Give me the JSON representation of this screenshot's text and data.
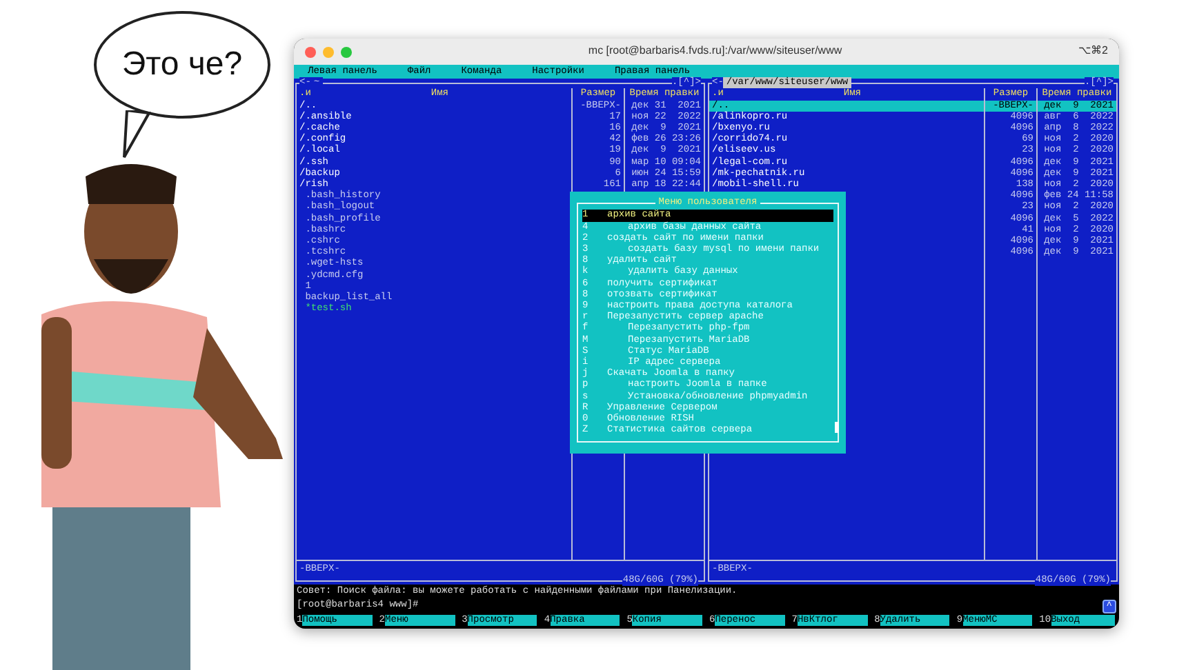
{
  "speech_bubble": {
    "text": "Это че?"
  },
  "window": {
    "title": "mc [root@barbaris4.fvds.ru]:/var/www/siteuser/www",
    "shortcut": "⌥⌘2"
  },
  "menu_bar": [
    "Левая панель",
    "Файл",
    "Команда",
    "Настройки",
    "Правая панель"
  ],
  "panels": [
    {
      "nav_left": "<-",
      "path": "~",
      "nav_right": ".[^]>",
      "active": false,
      "columns": [
        ".и",
        "Имя",
        "Размер",
        "Время правки"
      ],
      "rows": [
        {
          "name": "/..",
          "size": "-ВВЕРХ-",
          "time": "дек 31  2021",
          "kind": "dir",
          "selected": false
        },
        {
          "name": "/.ansible",
          "size": "17",
          "time": "ноя 22  2022",
          "kind": "dir",
          "selected": false
        },
        {
          "name": "/.cache",
          "size": "16",
          "time": "дек  9  2021",
          "kind": "dir",
          "selected": false
        },
        {
          "name": "/.config",
          "size": "42",
          "time": "фев 26 23:26",
          "kind": "dir",
          "selected": false
        },
        {
          "name": "/.local",
          "size": "19",
          "time": "дек  9  2021",
          "kind": "dir",
          "selected": false
        },
        {
          "name": "/.ssh",
          "size": "90",
          "time": "мар 10 09:04",
          "kind": "dir",
          "selected": false
        },
        {
          "name": "/backup",
          "size": "6",
          "time": "июн 24 15:59",
          "kind": "dir",
          "selected": false
        },
        {
          "name": "/rish",
          "size": "161",
          "time": "апр 18 22:44",
          "kind": "dir",
          "selected": false
        },
        {
          "name": ".bash_history",
          "kind": "file",
          "selected": false
        },
        {
          "name": ".bash_logout",
          "kind": "file",
          "selected": false
        },
        {
          "name": ".bash_profile",
          "kind": "file",
          "selected": false
        },
        {
          "name": ".bashrc",
          "kind": "file",
          "selected": false
        },
        {
          "name": ".cshrc",
          "kind": "file",
          "selected": false
        },
        {
          "name": ".tcshrc",
          "kind": "file",
          "selected": false
        },
        {
          "name": ".wget-hsts",
          "kind": "file",
          "selected": false
        },
        {
          "name": ".ydcmd.cfg",
          "kind": "file",
          "selected": false
        },
        {
          "name": "1",
          "kind": "file",
          "selected": false
        },
        {
          "name": "backup_list_all",
          "kind": "file",
          "selected": false
        },
        {
          "name": "*test.sh",
          "kind": "exec",
          "selected": false
        }
      ],
      "status": "-ВВЕРХ-",
      "disk": "48G/60G (79%)"
    },
    {
      "nav_left": "<-",
      "path": "/var/www/siteuser/www",
      "nav_right": ".[^]>",
      "active": true,
      "columns": [
        ".и",
        "Имя",
        "Размер",
        "Время правки"
      ],
      "rows": [
        {
          "name": "/..",
          "size": "-ВВЕРХ-",
          "time": "дек  9  2021",
          "kind": "dir",
          "selected": true
        },
        {
          "name": "/alinkopro.ru",
          "size": "4096",
          "time": "авг  6  2022",
          "kind": "dir",
          "selected": false
        },
        {
          "name": "/bxenyo.ru",
          "size": "4096",
          "time": "апр  8  2022",
          "kind": "dir",
          "selected": false
        },
        {
          "name": "/corrido74.ru",
          "size": "69",
          "time": "ноя  2  2020",
          "kind": "dir",
          "selected": false
        },
        {
          "name": "/eliseev.us",
          "size": "23",
          "time": "ноя  2  2020",
          "kind": "dir",
          "selected": false
        },
        {
          "name": "/legal-com.ru",
          "size": "4096",
          "time": "дек  9  2021",
          "kind": "dir",
          "selected": false
        },
        {
          "name": "/mk-pechatnik.ru",
          "size": "4096",
          "time": "дек  9  2021",
          "kind": "dir",
          "selected": false
        },
        {
          "name": "/mobil-shell.ru",
          "size": "138",
          "time": "ноя  2  2020",
          "kind": "dir",
          "selected": false
        },
        {
          "size": "4096",
          "time": "фев 24 11:58",
          "kind": "dir",
          "selected": false
        },
        {
          "size": "23",
          "time": "ноя  2  2020",
          "kind": "dir",
          "selected": false
        },
        {
          "size": "4096",
          "time": "дек  5  2022",
          "kind": "dir",
          "selected": false
        },
        {
          "size": "41",
          "time": "ноя  2  2020",
          "kind": "dir",
          "selected": false
        },
        {
          "size": "4096",
          "time": "дек  9  2021",
          "kind": "dir",
          "selected": false
        },
        {
          "size": "4096",
          "time": "дек  9  2021",
          "kind": "dir",
          "selected": false
        }
      ],
      "status": "-ВВЕРХ-",
      "disk": "48G/60G (79%)"
    }
  ],
  "user_menu": {
    "title": "Меню пользователя",
    "items": [
      {
        "key": "1",
        "label": "архив сайта",
        "indented": false,
        "selected": true
      },
      {
        "key": "4",
        "label": "архив базы данных сайта",
        "indented": true,
        "selected": false
      },
      {
        "key": "2",
        "label": "создать сайт по имени папки",
        "indented": false,
        "selected": false
      },
      {
        "key": "3",
        "label": "создать базу mysql по имени папки",
        "indented": true,
        "selected": false
      },
      {
        "key": "8",
        "label": "удалить сайт",
        "indented": false,
        "selected": false
      },
      {
        "key": "k",
        "label": "удалить базу данных",
        "indented": true,
        "selected": false
      },
      {
        "key": "6",
        "label": "получить сертификат",
        "indented": false,
        "selected": false
      },
      {
        "key": "8",
        "label": "отозвать сертификат",
        "indented": false,
        "selected": false
      },
      {
        "key": "9",
        "label": "настроить права доступа каталога",
        "indented": false,
        "selected": false
      },
      {
        "key": "r",
        "label": "Перезапустить сервер apache",
        "indented": false,
        "selected": false
      },
      {
        "key": "f",
        "label": "Перезапустить php-fpm",
        "indented": true,
        "selected": false
      },
      {
        "key": "M",
        "label": "Перезапустить MariaDB",
        "indented": true,
        "selected": false
      },
      {
        "key": "S",
        "label": "Статус MariaDB",
        "indented": true,
        "selected": false
      },
      {
        "key": "i",
        "label": "IP адрес сервера",
        "indented": true,
        "selected": false
      },
      {
        "key": "j",
        "label": "Скачать Joomla в папку",
        "indented": false,
        "selected": false
      },
      {
        "key": "p",
        "label": "настроить Joomla в папке",
        "indented": true,
        "selected": false
      },
      {
        "key": "s",
        "label": "Установка/обновление phpmyadmin",
        "indented": true,
        "selected": false
      },
      {
        "key": "R",
        "label": "Управление Сервером",
        "indented": false,
        "selected": false
      },
      {
        "key": "0",
        "label": "Обновление RISH",
        "indented": false,
        "selected": false
      },
      {
        "key": "Z",
        "label": "Статистика сайтов сервера",
        "indented": false,
        "selected": false
      }
    ]
  },
  "hint": "Совет: Поиск файла: вы можете работать с найденными файлами при Панелизации.",
  "prompt": "[root@barbaris4 www]#",
  "scroll_button": "^",
  "function_keys": [
    {
      "number": "1",
      "label": "Помощь"
    },
    {
      "number": "2",
      "label": "Меню"
    },
    {
      "number": "3",
      "label": "Просмотр"
    },
    {
      "number": "4",
      "label": "Правка"
    },
    {
      "number": "5",
      "label": "Копия"
    },
    {
      "number": "6",
      "label": "Перенос"
    },
    {
      "number": "7",
      "label": "НвКтлог"
    },
    {
      "number": "8",
      "label": "Удалить"
    },
    {
      "number": "9",
      "label": "МенюМС"
    },
    {
      "number": "10",
      "label": "Выход"
    }
  ]
}
